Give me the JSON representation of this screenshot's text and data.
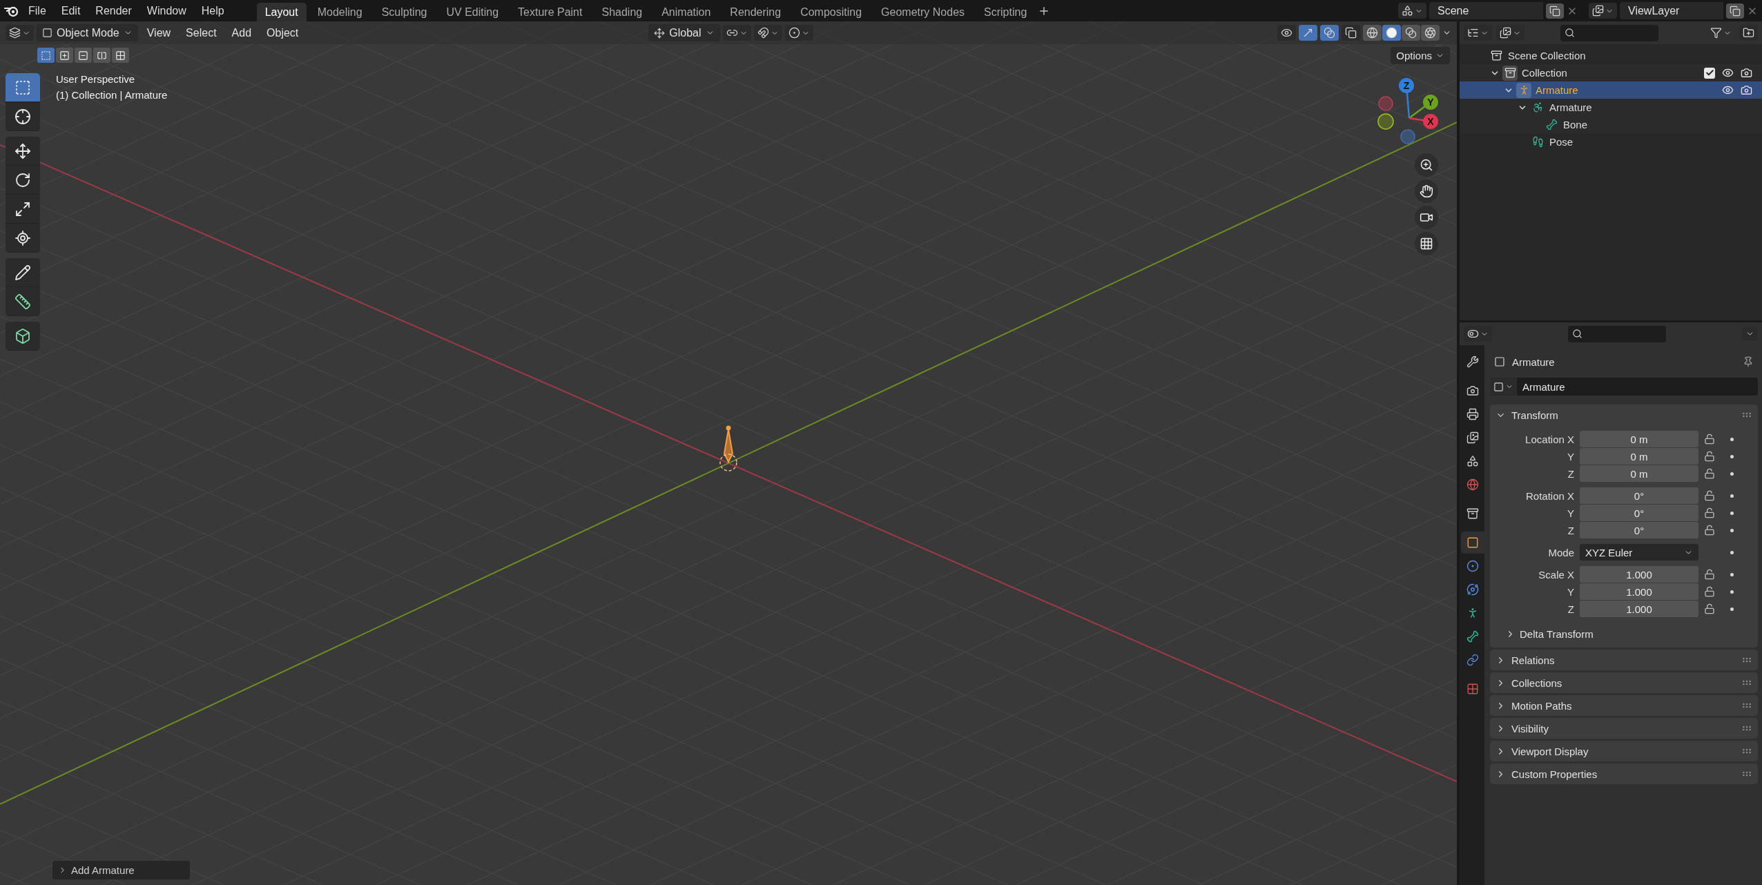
{
  "top_bar": {
    "menus": [
      "File",
      "Edit",
      "Render",
      "Window",
      "Help"
    ],
    "workspaces": [
      {
        "label": "Layout",
        "selected": true
      },
      {
        "label": "Modeling",
        "selected": false
      },
      {
        "label": "Sculpting",
        "selected": false
      },
      {
        "label": "UV Editing",
        "selected": false
      },
      {
        "label": "Texture Paint",
        "selected": false
      },
      {
        "label": "Shading",
        "selected": false
      },
      {
        "label": "Animation",
        "selected": false
      },
      {
        "label": "Rendering",
        "selected": false
      },
      {
        "label": "Compositing",
        "selected": false
      },
      {
        "label": "Geometry Nodes",
        "selected": false
      },
      {
        "label": "Scripting",
        "selected": false
      }
    ],
    "scene": "Scene",
    "view_layer": "ViewLayer"
  },
  "viewport": {
    "header": {
      "mode": "Object Mode",
      "menus": [
        "View",
        "Select",
        "Add",
        "Object"
      ],
      "orientation": "Global",
      "snapping": [
        {
          "kind": "snap",
          "on": false
        },
        {
          "kind": "proportional",
          "on": false
        }
      ],
      "toggles": [
        {
          "kind": "visibility",
          "on": false
        },
        {
          "kind": "gizmo",
          "on": true
        },
        {
          "kind": "overlay",
          "on": true
        },
        {
          "kind": "xray",
          "on": false
        }
      ],
      "shading": [
        {
          "kind": "wireframe",
          "selected": false
        },
        {
          "kind": "solid",
          "selected": true
        },
        {
          "kind": "material",
          "selected": false
        },
        {
          "kind": "rendered",
          "selected": false
        }
      ]
    },
    "select_modes": [
      {
        "kind": "set",
        "selected": true
      },
      {
        "kind": "extend",
        "selected": false
      },
      {
        "kind": "subtract",
        "selected": false
      },
      {
        "kind": "difference",
        "selected": false
      },
      {
        "kind": "intersect",
        "selected": false
      }
    ],
    "options": "Options",
    "info": [
      "User Perspective",
      "(1) Collection | Armature"
    ],
    "tool_groups": [
      {
        "tools": [
          {
            "kind": "select",
            "selected": true
          },
          {
            "kind": "cursor",
            "selected": false
          }
        ]
      },
      {
        "tools": [
          {
            "kind": "move",
            "selected": false
          },
          {
            "kind": "rotate",
            "selected": false
          },
          {
            "kind": "scale",
            "selected": false
          },
          {
            "kind": "transform",
            "selected": false
          }
        ]
      },
      {
        "tools": [
          {
            "kind": "annotate",
            "selected": false
          },
          {
            "kind": "measure",
            "selected": false
          }
        ]
      },
      {
        "tools": [
          {
            "kind": "add_cube",
            "selected": false
          }
        ]
      }
    ],
    "gizmo": {
      "z": "Z",
      "y": "Y",
      "x": "X"
    },
    "last_operator": "Add Armature"
  },
  "outliner": {
    "tree": [
      {
        "label": "Scene Collection",
        "kind": "scene_collection",
        "selected": false,
        "children": [
          {
            "label": "Collection",
            "kind": "collection",
            "selected": false,
            "expanded": true,
            "checked": true,
            "children": [
              {
                "label": "Armature",
                "kind": "object",
                "selected": true,
                "expanded": true,
                "children": [
                  {
                    "label": "Armature",
                    "kind": "armature_data",
                    "selected": false,
                    "expanded": true,
                    "children": [
                      {
                        "label": "Bone",
                        "kind": "bone",
                        "selected": false
                      }
                    ]
                  },
                  {
                    "label": "Pose",
                    "kind": "pose",
                    "selected": false
                  }
                ]
              }
            ]
          }
        ]
      }
    ]
  },
  "properties": {
    "tab_groups": [
      {
        "tabs": [
          {
            "kind": "tool",
            "selected": false
          }
        ]
      },
      {
        "tabs": [
          {
            "kind": "render",
            "selected": false
          },
          {
            "kind": "output",
            "selected": false
          },
          {
            "kind": "view_layer",
            "selected": false
          },
          {
            "kind": "scene",
            "selected": false
          },
          {
            "kind": "world",
            "selected": false
          }
        ]
      },
      {
        "tabs": [
          {
            "kind": "collection",
            "selected": false
          }
        ]
      },
      {
        "tabs": [
          {
            "kind": "object",
            "selected": true
          },
          {
            "kind": "physics",
            "selected": false
          },
          {
            "kind": "object_constraint",
            "selected": false
          },
          {
            "kind": "armature_data",
            "selected": false
          },
          {
            "kind": "bone",
            "selected": false
          },
          {
            "kind": "bone_constraint",
            "selected": false
          }
        ]
      },
      {
        "tabs": [
          {
            "kind": "texture",
            "selected": false
          }
        ]
      }
    ],
    "context": "Armature",
    "name": "Armature",
    "panels": [
      {
        "title": "Transform",
        "expanded": true,
        "groups": [
          {
            "rows": [
              {
                "label": "Location X",
                "kind": "number",
                "value": "0 m"
              },
              {
                "label": "Y",
                "kind": "number",
                "value": "0 m"
              },
              {
                "label": "Z",
                "kind": "number",
                "value": "0 m"
              }
            ]
          },
          {
            "rows": [
              {
                "label": "Rotation X",
                "kind": "number",
                "value": "0°"
              },
              {
                "label": "Y",
                "kind": "number",
                "value": "0°"
              },
              {
                "label": "Z",
                "kind": "number",
                "value": "0°"
              }
            ]
          },
          {
            "rows": [
              {
                "label": "Mode",
                "kind": "dropdown",
                "value": "XYZ Euler"
              }
            ]
          },
          {
            "rows": [
              {
                "label": "Scale X",
                "kind": "number",
                "value": "1.000"
              },
              {
                "label": "Y",
                "kind": "number",
                "value": "1.000"
              },
              {
                "label": "Z",
                "kind": "number",
                "value": "1.000"
              }
            ]
          }
        ],
        "subpanels": [
          {
            "title": "Delta Transform",
            "expanded": false
          }
        ]
      },
      {
        "title": "Relations",
        "expanded": false
      },
      {
        "title": "Collections",
        "expanded": false
      },
      {
        "title": "Motion Paths",
        "expanded": false
      },
      {
        "title": "Visibility",
        "expanded": false
      },
      {
        "title": "Viewport Display",
        "expanded": false
      },
      {
        "title": "Custom Properties",
        "expanded": false
      }
    ]
  }
}
